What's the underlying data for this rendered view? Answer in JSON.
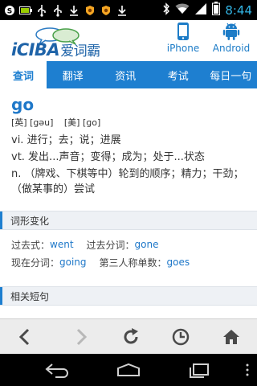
{
  "status_bar": {
    "time": "8:44",
    "left_icons": [
      "skype-icon",
      "battery-full-icon",
      "usb-icon",
      "usb-icon",
      "download-icon",
      "app-icon",
      "app-icon",
      "download-icon"
    ],
    "right_icons": [
      "bluetooth-icon",
      "wifi-icon",
      "signal-icon",
      "battery-icon"
    ]
  },
  "header": {
    "logo_text": "iCIBA",
    "logo_cn": "爱词霸",
    "platforms": [
      {
        "label": "iPhone",
        "icon": "phone-icon"
      },
      {
        "label": "Android",
        "icon": "android-icon"
      }
    ]
  },
  "tabs": [
    "查词",
    "翻译",
    "资讯",
    "考试",
    "每日一句"
  ],
  "active_tab": 0,
  "entry": {
    "word": "go",
    "phonetic_uk": "[英] [gəu]",
    "phonetic_us": "[美] [ɡo]",
    "definitions": [
      "vi. 进行；去；说；进展",
      "vt. 发出...声音；变得；成为；处于...状态",
      "n. （牌戏、下棋等中）轮到的顺序；精力；干劲；（做某事的）尝试"
    ]
  },
  "forms_section": {
    "title": "词形变化",
    "past_label": "过去式：",
    "past": "went",
    "past_participle_label": "过去分词：",
    "past_participle": "gone",
    "present_participle_label": "现在分词：",
    "present_participle": "going",
    "third_person_label": "第三人称单数：",
    "third_person": "goes"
  },
  "phrases_section": {
    "title": "相关短句"
  },
  "browser_toolbar": [
    "back-icon",
    "forward-icon",
    "refresh-icon",
    "history-icon",
    "home-icon"
  ],
  "nav_bar": [
    "back-icon",
    "home-icon",
    "recents-icon"
  ],
  "colors": {
    "accent": "#1e7fd0",
    "link": "#1f78c9",
    "clock": "#33b5e5"
  }
}
